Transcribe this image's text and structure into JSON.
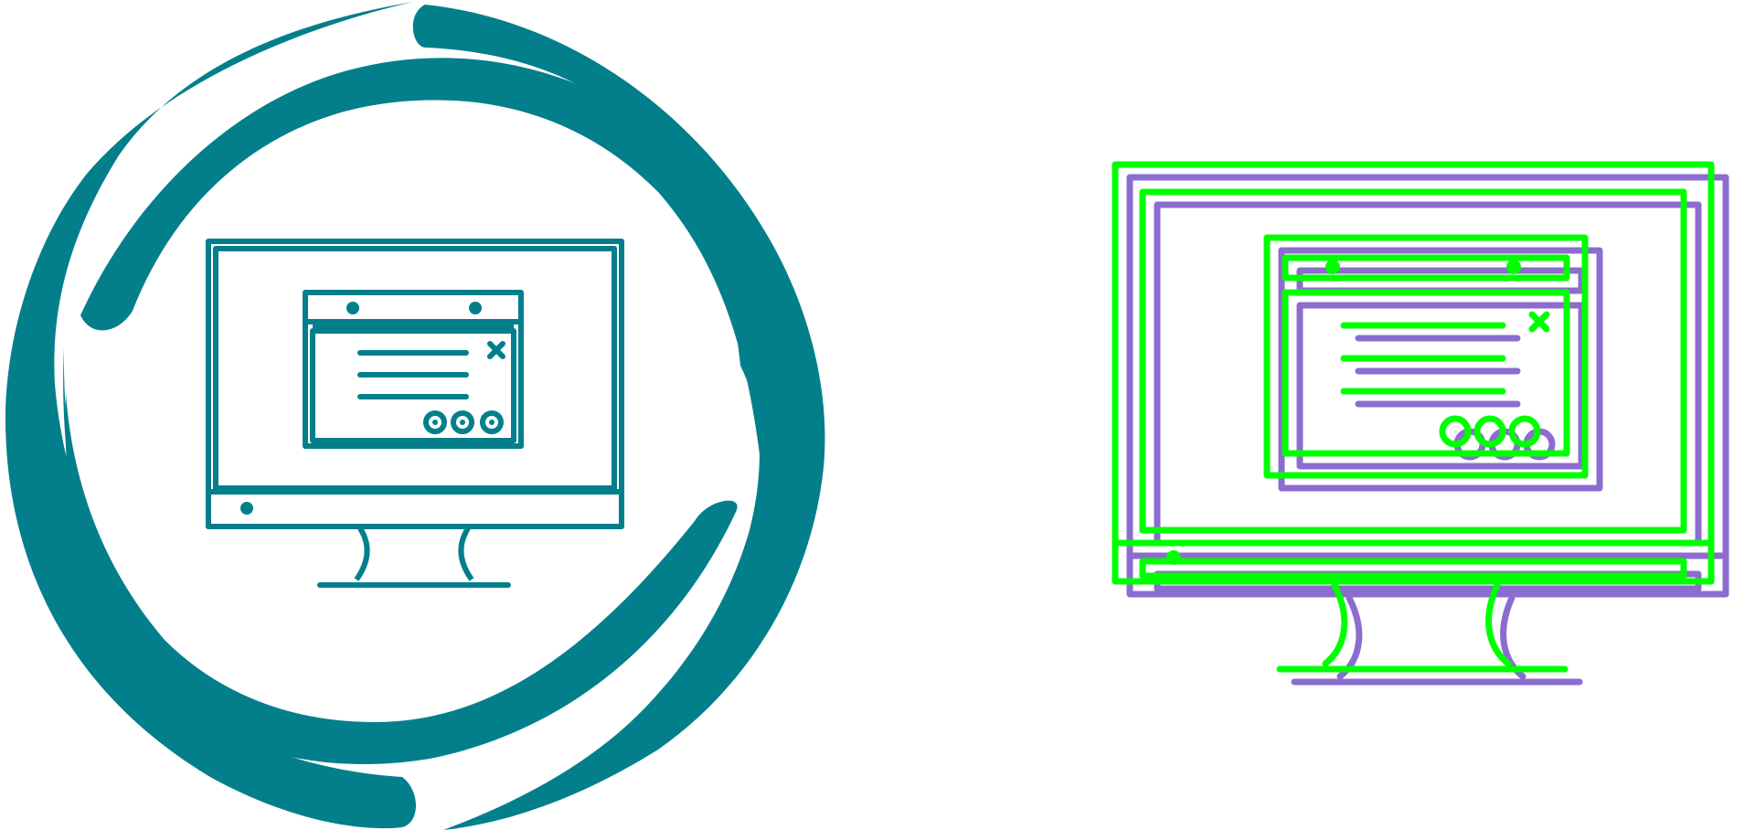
{
  "icons": [
    {
      "name": "computer-with-dialog-icon",
      "style": "glyph-with-circular-arrows",
      "color": "#037f8c"
    },
    {
      "name": "computer-with-dialog-icon",
      "style": "offset-outline",
      "colors": {
        "primary": "#00ff00",
        "shadow": "#8c6ccf"
      }
    }
  ]
}
